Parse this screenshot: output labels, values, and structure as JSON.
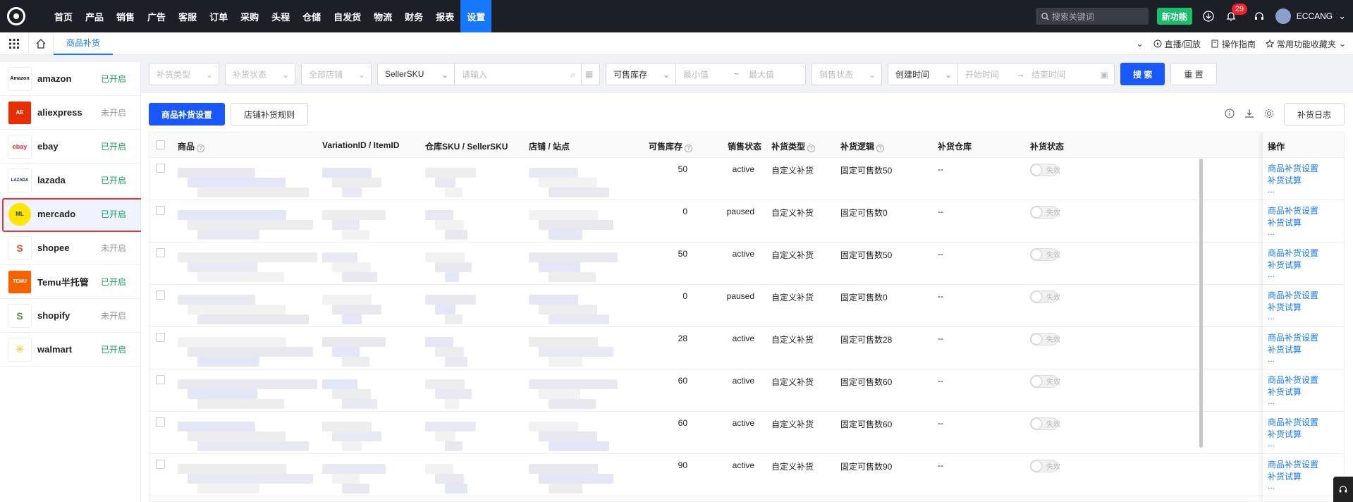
{
  "nav": {
    "items": [
      "首页",
      "产品",
      "销售",
      "广告",
      "客服",
      "订单",
      "采购",
      "头程",
      "仓储",
      "自发货",
      "物流",
      "财务",
      "报表",
      "设置"
    ],
    "active_index": 13
  },
  "top": {
    "search_placeholder": "搜索关键词",
    "new_feature": "新功能",
    "notif_count": "29",
    "user": "ECCANG"
  },
  "tabbar": {
    "tab": "商品补货",
    "live": "直播/回放",
    "guide": "操作指南",
    "favorites": "常用功能收藏夹"
  },
  "sidebar": {
    "items": [
      {
        "name": "amazon",
        "status": "已开启",
        "on": true,
        "logo": "Amazon"
      },
      {
        "name": "aliexpress",
        "status": "未开启",
        "on": false,
        "logo": "AE"
      },
      {
        "name": "ebay",
        "status": "已开启",
        "on": true,
        "logo": "ebay"
      },
      {
        "name": "lazada",
        "status": "已开启",
        "on": true,
        "logo": "LAZADA"
      },
      {
        "name": "mercado",
        "status": "已开启",
        "on": true,
        "logo": "ML"
      },
      {
        "name": "shopee",
        "status": "未开启",
        "on": false,
        "logo": "S"
      },
      {
        "name": "Temu半托管",
        "status": "已开启",
        "on": true,
        "logo": "TEMU"
      },
      {
        "name": "shopify",
        "status": "未开启",
        "on": false,
        "logo": "S"
      },
      {
        "name": "walmart",
        "status": "已开启",
        "on": true,
        "logo": "✳"
      }
    ],
    "selected_index": 4
  },
  "filters": {
    "type": "补货类型",
    "status": "补货状态",
    "store": "全部店铺",
    "sku_field": "SellerSKU",
    "sku_placeholder": "请输入",
    "stock_field": "可售库存",
    "min": "最小值",
    "max": "最大值",
    "sale_status": "销售状态",
    "time_field": "创建时间",
    "start": "开始时间",
    "end": "结束时间",
    "search": "搜 索",
    "reset": "重 置"
  },
  "actions": {
    "product_setting": "商品补货设置",
    "store_rule": "店铺补货规则",
    "log": "补货日志"
  },
  "table": {
    "headers": {
      "product": "商品",
      "variation": "VariationID / ItemID",
      "sku": "仓库SKU / SellerSKU",
      "store": "店铺 / 站点",
      "stock": "可售库存",
      "sale_status": "销售状态",
      "type": "补货类型",
      "logic": "补货逻辑",
      "warehouse": "补货仓库",
      "rep_status": "补货状态",
      "ops": "操作"
    },
    "rows": [
      {
        "stock": "50",
        "status": "active",
        "type": "自定义补货",
        "logic": "固定可售数50",
        "warehouse": "--"
      },
      {
        "stock": "0",
        "status": "paused",
        "type": "自定义补货",
        "logic": "固定可售数0",
        "warehouse": "--"
      },
      {
        "stock": "50",
        "status": "active",
        "type": "自定义补货",
        "logic": "固定可售数50",
        "warehouse": "--"
      },
      {
        "stock": "0",
        "status": "paused",
        "type": "自定义补货",
        "logic": "固定可售数0",
        "warehouse": "--"
      },
      {
        "stock": "28",
        "status": "active",
        "type": "自定义补货",
        "logic": "固定可售数28",
        "warehouse": "--"
      },
      {
        "stock": "60",
        "status": "active",
        "type": "自定义补货",
        "logic": "固定可售数60",
        "warehouse": "--"
      },
      {
        "stock": "60",
        "status": "active",
        "type": "自定义补货",
        "logic": "固定可售数60",
        "warehouse": "--"
      },
      {
        "stock": "90",
        "status": "active",
        "type": "自定义补货",
        "logic": "固定可售数90",
        "warehouse": "--"
      }
    ],
    "toggle_label": "失效",
    "op_setting": "商品补货设置",
    "op_trial": "补货试算",
    "op_more": "..."
  },
  "colors": {
    "on": "#19a15f",
    "off": "#999999",
    "accent": "#1677ff"
  }
}
